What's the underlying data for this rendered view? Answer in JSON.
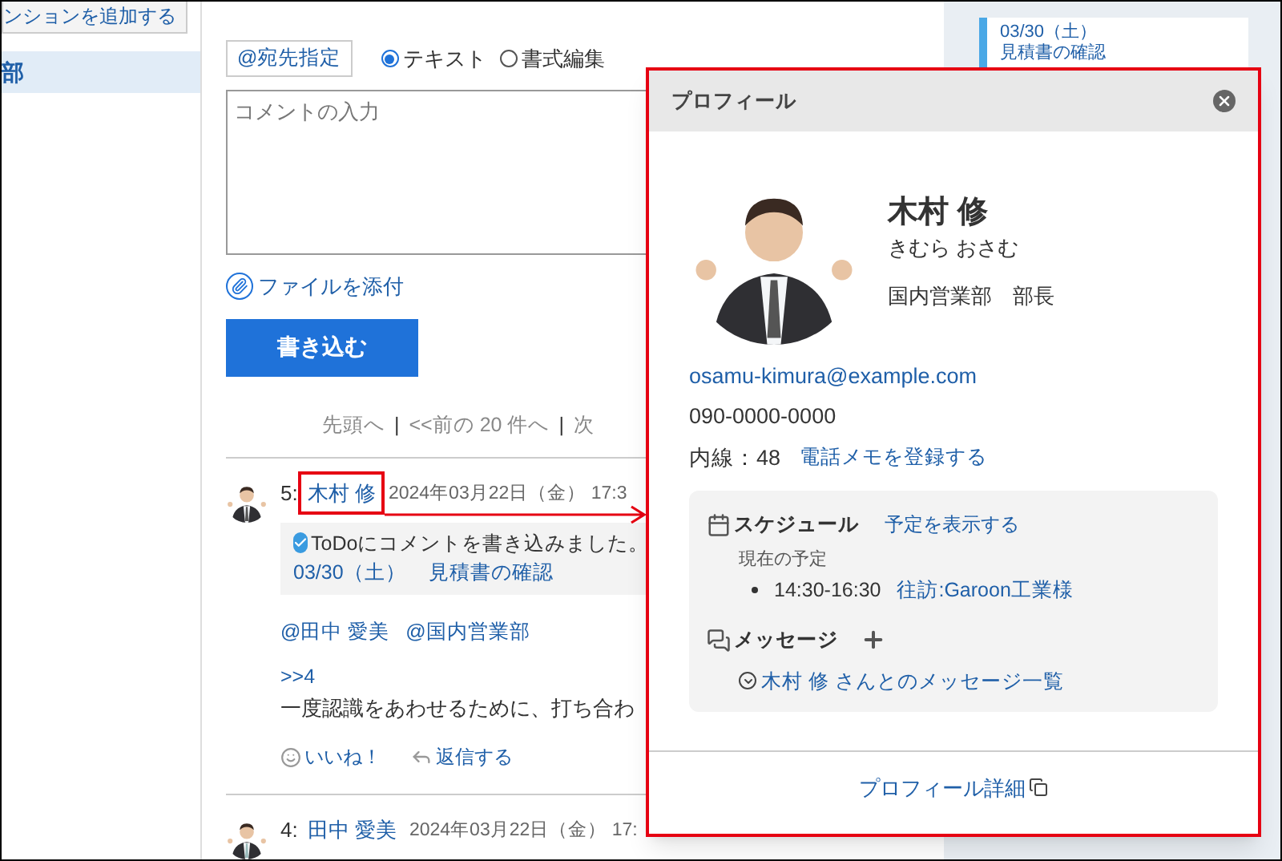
{
  "sidebar": {
    "add_button": "ンションを追加する",
    "items": [
      {
        "label": "部",
        "selected": true
      }
    ]
  },
  "composer": {
    "mention_button": "@宛先指定",
    "formats": [
      {
        "label": "テキスト",
        "selected": true
      },
      {
        "label": "書式編集",
        "selected": false
      }
    ],
    "comment": {
      "placeholder": "コメントの入力"
    },
    "attach": "ファイルを添付",
    "submit": "書き込む"
  },
  "pagination": [
    {
      "kind": "link",
      "text": "先頭へ"
    },
    {
      "kind": "separator",
      "text": "|"
    },
    {
      "kind": "link",
      "text": "<<前の 20 件へ"
    },
    {
      "kind": "separator",
      "text": "|"
    },
    {
      "kind": "link",
      "text": "次"
    }
  ],
  "posts": [
    {
      "number": "5:",
      "author": "木村 修",
      "date": "2024年03月22日（金） 17:3",
      "highlighted": true,
      "todo": {
        "text": "ToDoにコメントを書き込みました。",
        "date": "03/30（土）",
        "title": "見積書の確認"
      },
      "mentions": [
        "@田中 愛美",
        "@国内営業部"
      ],
      "quote": ">>4",
      "body": "一度認識をあわせるために、打ち合わ",
      "actions": [
        {
          "kind": "like",
          "label": "いいね！"
        },
        {
          "kind": "reply",
          "label": "返信する"
        }
      ]
    },
    {
      "number": "4:",
      "author": "田中 愛美",
      "date": "2024年03月22日（金） 17:",
      "highlighted": false
    }
  ],
  "calendar_panel": {
    "entries": [
      {
        "date": "03/30（土）",
        "title": "見積書の確認"
      }
    ]
  },
  "profile_popup": {
    "title": "プロフィール",
    "name": "木村 修",
    "kana": "きむら おさむ",
    "department": "国内営業部　部長",
    "email": "osamu-kimura@example.com",
    "phone": "090-0000-0000",
    "extension": "内線：48",
    "phone_memo_link": "電話メモを登録する",
    "schedule": {
      "label": "スケジュール",
      "link": "予定を表示する",
      "current_label": "現在の予定",
      "events": [
        {
          "time": "14:30-16:30",
          "title": "往訪:Garoon工業様"
        }
      ]
    },
    "messages": {
      "label": "メッセージ",
      "list_link": "木村 修 さんとのメッセージ一覧"
    },
    "details_link": "プロフィール詳細"
  }
}
